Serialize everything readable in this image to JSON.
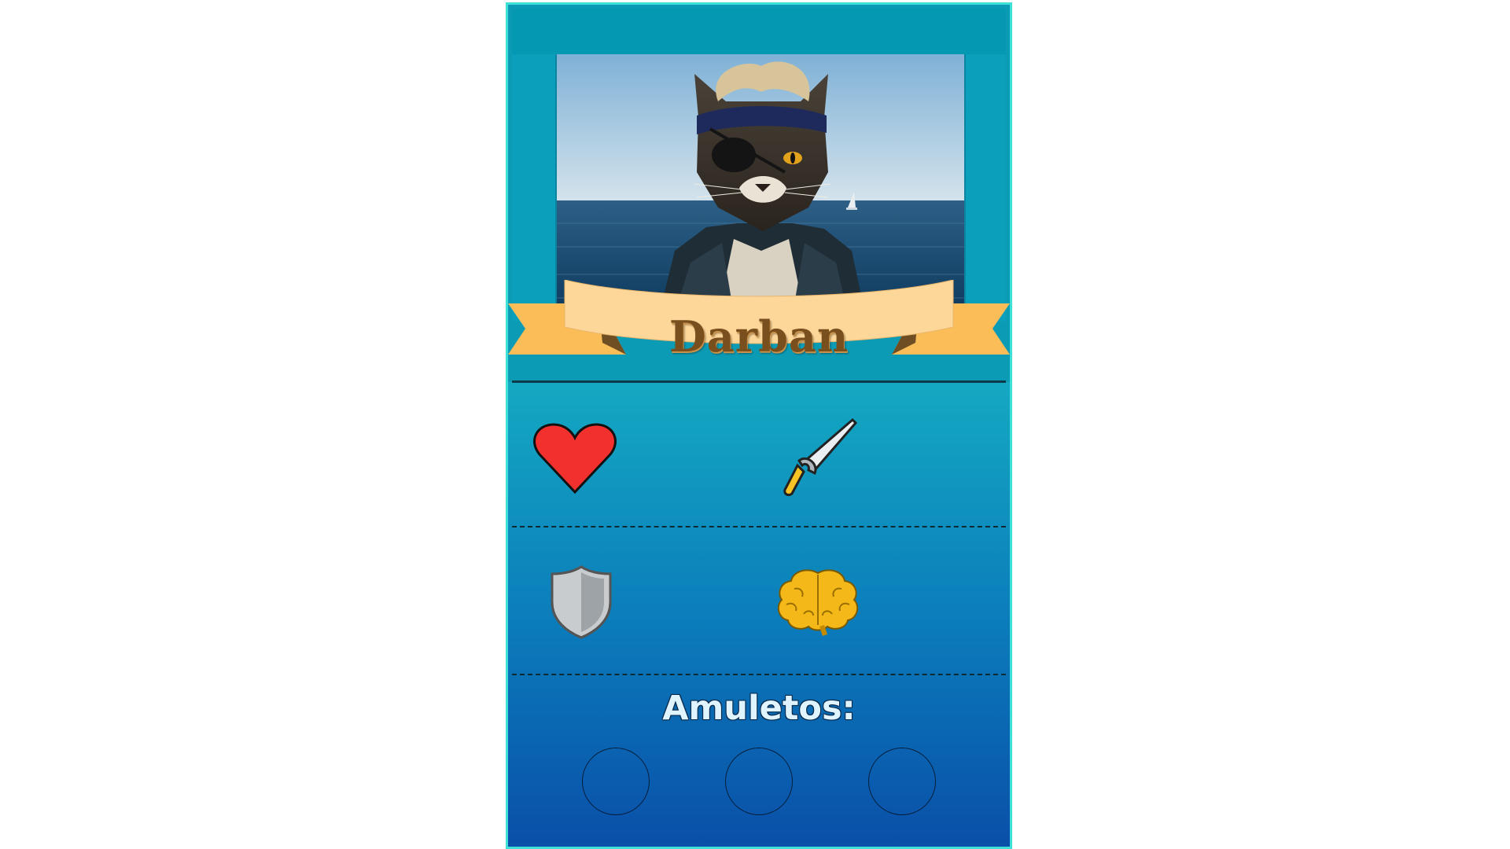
{
  "card": {
    "character_name": "Darban",
    "stats": [
      {
        "icon": "heart-icon"
      },
      {
        "icon": "sword-icon"
      },
      {
        "icon": "shield-icon"
      },
      {
        "icon": "brain-icon"
      }
    ],
    "amulets_label": "Amuletos:",
    "amulet_slots": 3
  },
  "colors": {
    "card_border": "#3fe0d8",
    "banner": "#fdd79a",
    "banner_tails": "#fbbd57",
    "name_text": "#7a4f1e",
    "heart": "#f2302d",
    "brain": "#f5b819"
  }
}
